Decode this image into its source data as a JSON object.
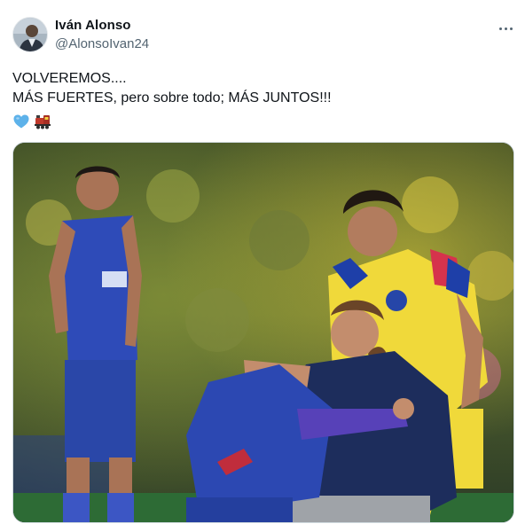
{
  "author": {
    "display_name": "Iván Alonso",
    "handle": "@AlonsoIvan24"
  },
  "tweet": {
    "lines": [
      "VOLVEREMOS....",
      "MÁS FUERTES, pero sobre todo; MÁS JUNTOS!!!"
    ],
    "emojis": [
      "blue-heart-icon",
      "locomotive-icon"
    ]
  },
  "media": {
    "kind": "photo",
    "subject": "football-players-embracing-on-pitch"
  },
  "colors": {
    "text_primary": "#0f1419",
    "text_secondary": "#536471",
    "border": "#cfd9de",
    "heart_blue": "#5db2ea"
  }
}
